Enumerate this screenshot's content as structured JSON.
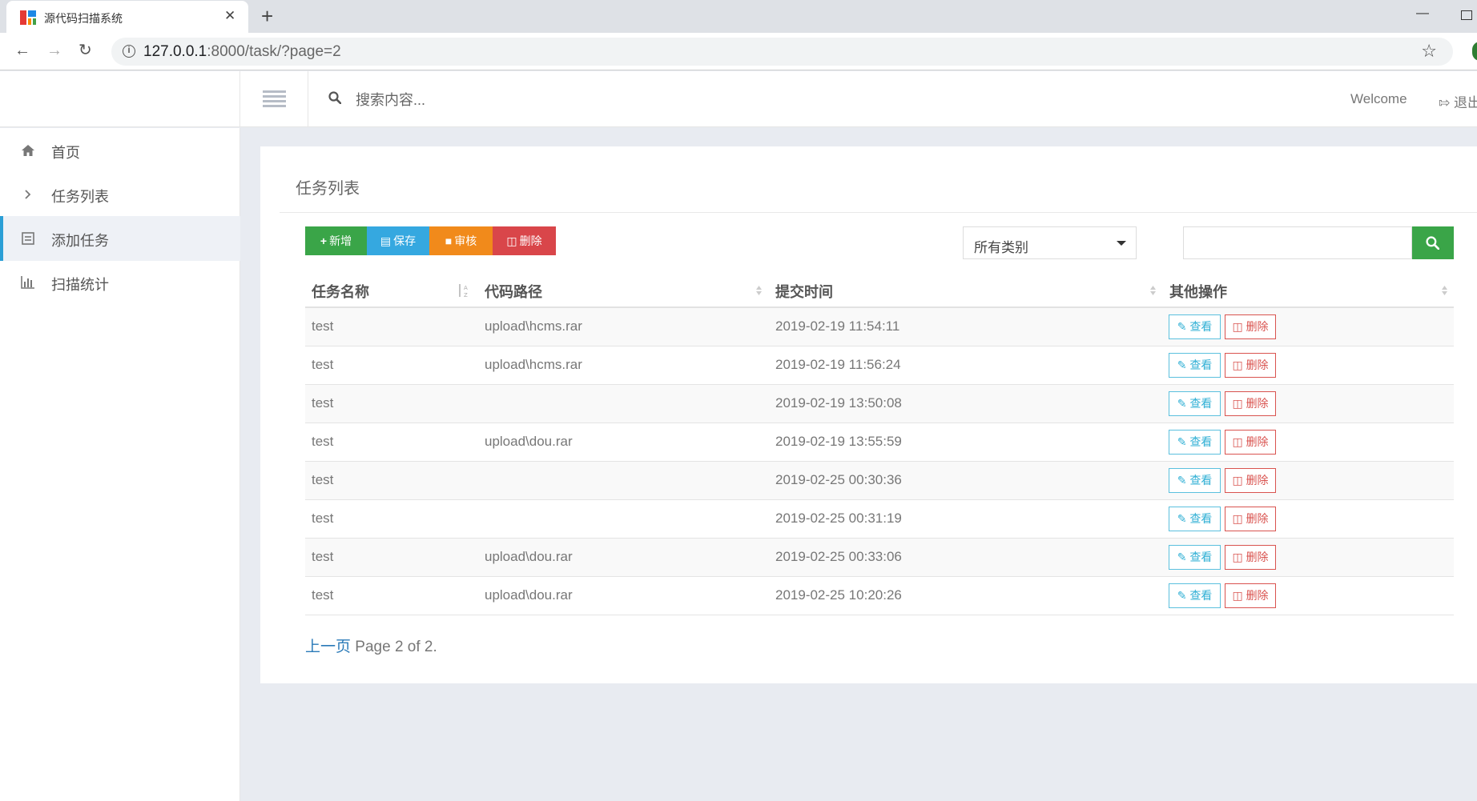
{
  "browser": {
    "tab_title": "源代码扫描系统",
    "tab_close": "✕",
    "new_tab": "+",
    "url_host": "127.0.0.1",
    "url_path": ":8000/task/?page=2",
    "window_min": "—"
  },
  "header": {
    "search_placeholder": "搜索内容...",
    "welcome": "Welcome",
    "logout": "退出"
  },
  "sidebar": {
    "items": [
      {
        "label": "首页",
        "icon": "home-icon"
      },
      {
        "label": "任务列表",
        "icon": "chevron-right-icon"
      },
      {
        "label": "添加任务",
        "icon": "form-icon"
      },
      {
        "label": "扫描统计",
        "icon": "bar-chart-icon"
      }
    ]
  },
  "panel": {
    "title": "任务列表",
    "buttons": {
      "add": "新增",
      "save": "保存",
      "review": "审核",
      "delete": "删除"
    },
    "button_colors": {
      "add": "#3aa548",
      "save": "#35a8e0",
      "review": "#f18a1b",
      "delete": "#d9464a"
    },
    "category_select": "所有类别",
    "search_value": ""
  },
  "table": {
    "headers": [
      "任务名称",
      "代码路径",
      "提交时间",
      "其他操作"
    ],
    "view_label": "查看",
    "delete_label": "删除",
    "rows": [
      {
        "name": "test",
        "path": "upload\\hcms.rar",
        "time": "2019-02-19 11:54:11"
      },
      {
        "name": "test",
        "path": "upload\\hcms.rar",
        "time": "2019-02-19 11:56:24"
      },
      {
        "name": "test",
        "path": "",
        "time": "2019-02-19 13:50:08"
      },
      {
        "name": "test",
        "path": "upload\\dou.rar",
        "time": "2019-02-19 13:55:59"
      },
      {
        "name": "test",
        "path": "",
        "time": "2019-02-25 00:30:36"
      },
      {
        "name": "test",
        "path": "",
        "time": "2019-02-25 00:31:19"
      },
      {
        "name": "test",
        "path": "upload\\dou.rar",
        "time": "2019-02-25 00:33:06"
      },
      {
        "name": "test",
        "path": "upload\\dou.rar",
        "time": "2019-02-25 10:20:26"
      }
    ]
  },
  "pagination": {
    "prev": "上一页",
    "info": "Page 2 of 2."
  }
}
